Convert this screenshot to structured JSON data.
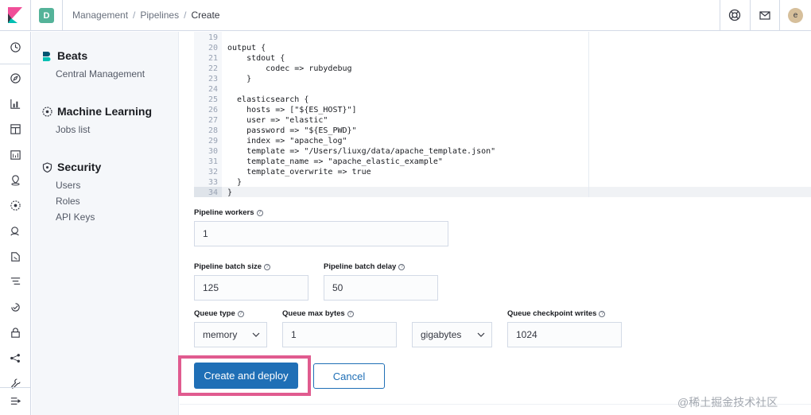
{
  "topbar": {
    "space_initial": "D",
    "breadcrumbs": [
      "Management",
      "Pipelines",
      "Create"
    ],
    "user_initial": "e"
  },
  "sidenav": {
    "groups": [
      {
        "title": "Beats",
        "items": [
          "Central Management"
        ]
      },
      {
        "title": "Machine Learning",
        "items": [
          "Jobs list"
        ]
      },
      {
        "title": "Security",
        "items": [
          "Users",
          "Roles",
          "API Keys"
        ]
      }
    ]
  },
  "editor": {
    "lines": [
      {
        "n": "19",
        "t": ""
      },
      {
        "n": "20",
        "t": "output {"
      },
      {
        "n": "21",
        "t": "    stdout {"
      },
      {
        "n": "22",
        "t": "        codec => rubydebug"
      },
      {
        "n": "23",
        "t": "    }"
      },
      {
        "n": "24",
        "t": ""
      },
      {
        "n": "25",
        "t": "  elasticsearch {"
      },
      {
        "n": "26",
        "t": "    hosts => [\"${ES_HOST}\"]"
      },
      {
        "n": "27",
        "t": "    user => \"elastic\""
      },
      {
        "n": "28",
        "t": "    password => \"${ES_PWD}\""
      },
      {
        "n": "29",
        "t": "    index => \"apache_log\""
      },
      {
        "n": "30",
        "t": "    template => \"/Users/liuxg/data/apache_template.json\""
      },
      {
        "n": "31",
        "t": "    template_name => \"apache_elastic_example\""
      },
      {
        "n": "32",
        "t": "    template_overwrite => true"
      },
      {
        "n": "33",
        "t": "  }"
      },
      {
        "n": "34",
        "t": "}"
      }
    ]
  },
  "form": {
    "pipeline_workers": {
      "label": "Pipeline workers",
      "value": "1"
    },
    "batch_size": {
      "label": "Pipeline batch size",
      "value": "125"
    },
    "batch_delay": {
      "label": "Pipeline batch delay",
      "value": "50"
    },
    "queue_type": {
      "label": "Queue type",
      "value": "memory"
    },
    "queue_max_bytes": {
      "label": "Queue max bytes",
      "value": "1"
    },
    "queue_units": {
      "value": "gigabytes"
    },
    "checkpoint_writes": {
      "label": "Queue checkpoint writes",
      "value": "1024"
    }
  },
  "actions": {
    "create_label": "Create and deploy",
    "cancel_label": "Cancel"
  },
  "watermark": "@稀土掘金技术社区",
  "colors": {
    "primary": "#1f6fb6",
    "highlight": "#e05b8f",
    "space_badge": "#54b399"
  }
}
